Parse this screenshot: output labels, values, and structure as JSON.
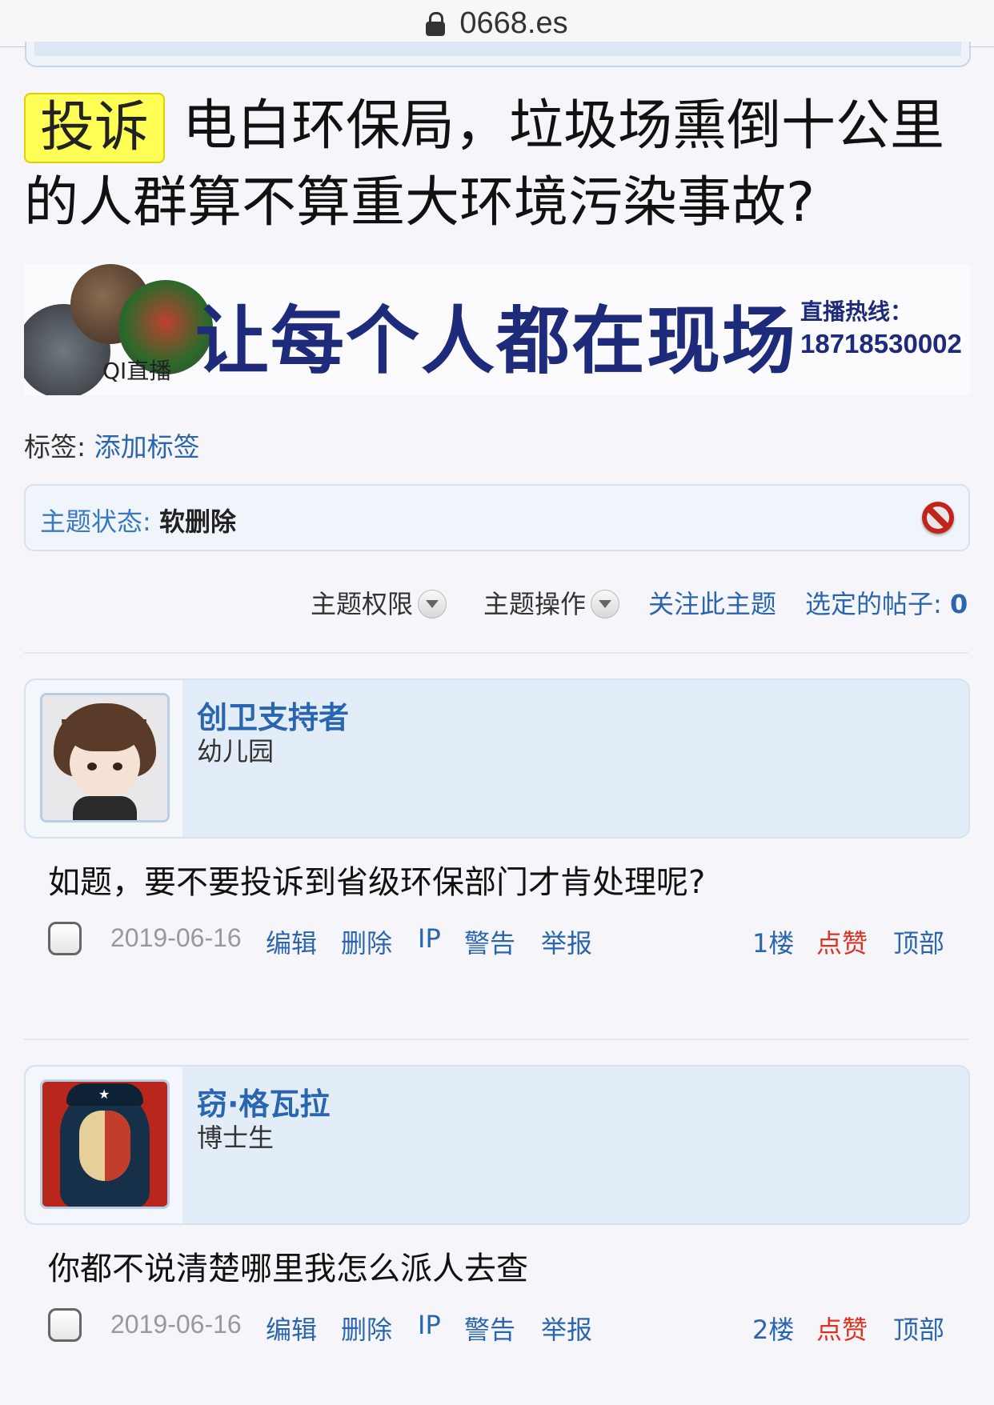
{
  "browser": {
    "url": "0668.es"
  },
  "thread": {
    "badge": "投诉",
    "title": "电白环保局，垃圾场熏倒十公里的人群算不算重大环境污染事故?"
  },
  "banner": {
    "logo_text": "QI直播",
    "slogan": "让每个人都在现场",
    "hotline_label": "直播热线：",
    "hotline_number": "18718530002"
  },
  "tags": {
    "label": "标签:",
    "add_link": "添加标签"
  },
  "status": {
    "label": "主题状态:",
    "value": "软删除"
  },
  "actions": {
    "permissions": "主题权限",
    "operations": "主题操作",
    "follow": "关注此主题",
    "selected_label": "选定的帖子:",
    "selected_count": "0"
  },
  "posts": [
    {
      "username": "创卫支持者",
      "rank": "幼儿园",
      "content": "如题，要不要投诉到省级环保部门才肯处理呢?",
      "date": "2019-06-16",
      "edit": "编辑",
      "delete": "删除",
      "ip": "IP",
      "warn": "警告",
      "report": "举报",
      "floor": "1楼",
      "like": "点赞",
      "top": "顶部"
    },
    {
      "username": "窃·格瓦拉",
      "rank": "博士生",
      "content": "你都不说清楚哪里我怎么派人去查",
      "date": "2019-06-16",
      "edit": "编辑",
      "delete": "删除",
      "ip": "IP",
      "warn": "警告",
      "report": "举报",
      "floor": "2楼",
      "like": "点赞",
      "top": "顶部"
    }
  ]
}
